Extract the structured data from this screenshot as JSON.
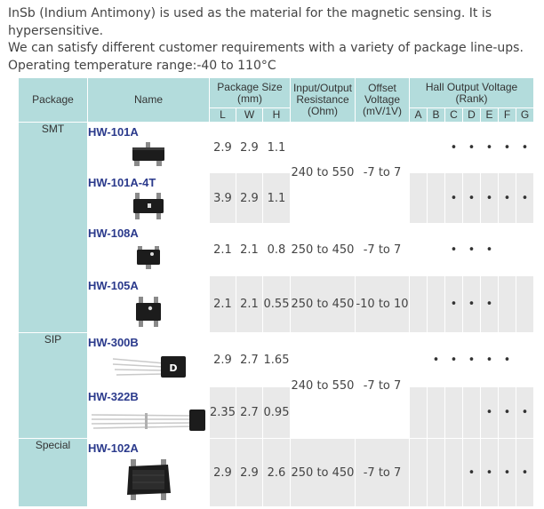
{
  "intro": {
    "line1": "InSb (Indium Antimony) is used as the material for the magnetic sensing. It is hypersensitive.",
    "line2": "We can satisfy different customer requirements with a variety of package line-ups.",
    "line3": "Operating temperature range:-40 to 110°C"
  },
  "header": {
    "package": "Package",
    "name": "Name",
    "size": "Package Size (mm)",
    "size_l": "L",
    "size_w": "W",
    "size_h": "H",
    "resistance": "Input/Output Resistance (Ohm)",
    "offset": "Offset Voltage (mV/1V)",
    "hall": "Hall Output Voltage (Rank)",
    "ranks": [
      "A",
      "B",
      "C",
      "D",
      "E",
      "F",
      "G"
    ]
  },
  "groups": {
    "smt": "SMT",
    "sip": "SIP",
    "special": "Special"
  },
  "rows": [
    {
      "name": "HW-101A",
      "L": "2.9",
      "W": "2.9",
      "H": "1.1",
      "ranks": [
        false,
        false,
        true,
        true,
        true,
        true,
        true
      ]
    },
    {
      "name": "HW-101A-4T",
      "L": "3.9",
      "W": "2.9",
      "H": "1.1",
      "ranks": [
        false,
        false,
        true,
        true,
        true,
        true,
        true
      ]
    },
    {
      "name": "HW-108A",
      "L": "2.1",
      "W": "2.1",
      "H": "0.8",
      "resistance": "250 to 450",
      "offset": "-7 to 7",
      "ranks": [
        false,
        false,
        true,
        true,
        true,
        false,
        false
      ]
    },
    {
      "name": "HW-105A",
      "L": "2.1",
      "W": "2.1",
      "H": "0.55",
      "resistance": "250 to 450",
      "offset": "-10 to 10",
      "ranks": [
        false,
        false,
        true,
        true,
        true,
        false,
        false
      ]
    },
    {
      "name": "HW-300B",
      "L": "2.9",
      "W": "2.7",
      "H": "1.65",
      "ranks": [
        false,
        true,
        true,
        true,
        true,
        true,
        false
      ]
    },
    {
      "name": "HW-322B",
      "L": "2.35",
      "W": "2.7",
      "H": "0.95",
      "ranks": [
        false,
        false,
        false,
        false,
        true,
        true,
        true
      ]
    },
    {
      "name": "HW-102A",
      "L": "2.9",
      "W": "2.9",
      "H": "2.6",
      "resistance": "250 to 450",
      "offset": "-7 to 7",
      "ranks": [
        false,
        false,
        false,
        true,
        true,
        true,
        true
      ]
    }
  ],
  "merged": {
    "smt_resistance": "240 to 550",
    "smt_offset": "-7 to 7",
    "sip_resistance": "240 to 550",
    "sip_offset": "-7 to 7"
  },
  "dot_symbol": "•"
}
